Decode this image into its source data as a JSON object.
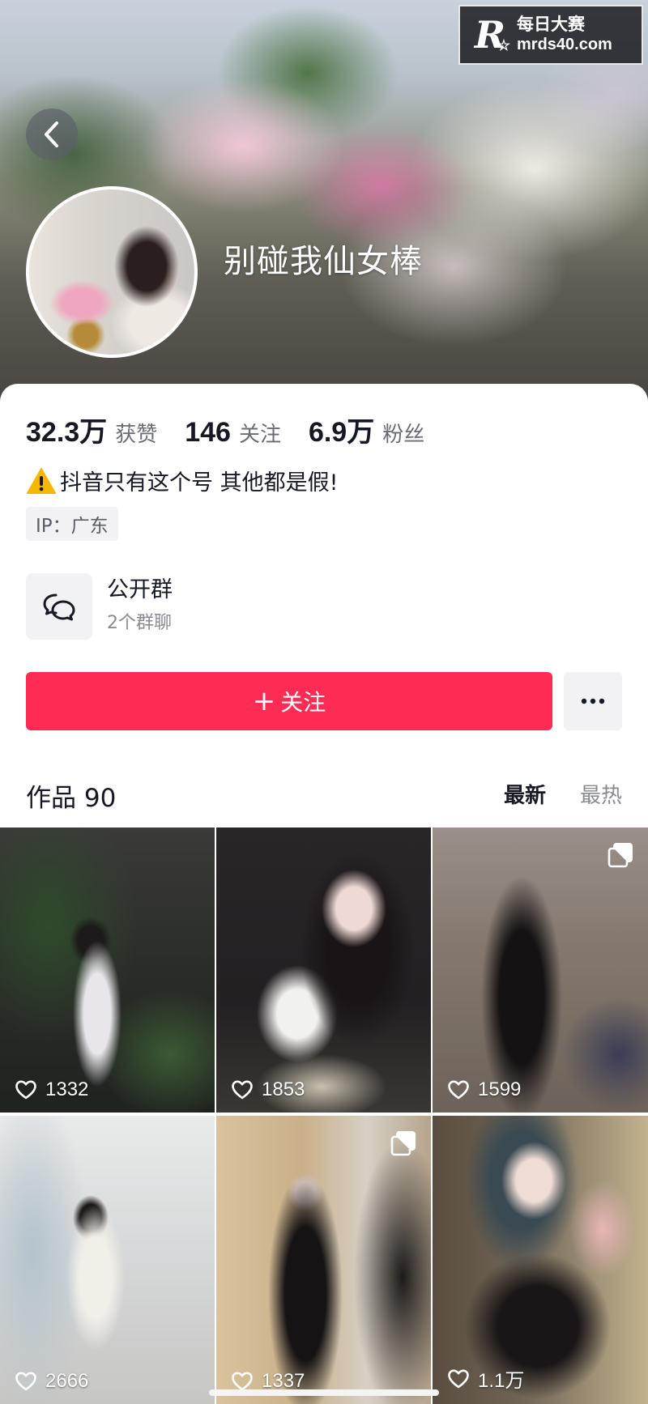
{
  "watermark": {
    "logo": "R",
    "line1": "每日大赛",
    "line2": "mrds40.com"
  },
  "profile": {
    "name": "别碰我仙女棒"
  },
  "stats": [
    {
      "value": "32.3万",
      "label": "获赞"
    },
    {
      "value": "146",
      "label": "关注"
    },
    {
      "value": "6.9万",
      "label": "粉丝"
    }
  ],
  "bio": {
    "icon": "warning-icon",
    "text": "抖音只有这个号 其他都是假!"
  },
  "ip": {
    "text": "IP：广东"
  },
  "group": {
    "icon": "chat-bubbles-icon",
    "title": "公开群",
    "subtitle": "2个群聊"
  },
  "actions": {
    "follow_label": "关注",
    "follow_plus": "+",
    "follow_color": "#fe2c55"
  },
  "works": {
    "title": "作品 90",
    "sort_tabs": [
      {
        "label": "最新",
        "active": true
      },
      {
        "label": "最热",
        "active": false
      }
    ],
    "items": [
      {
        "likes": "1332",
        "multi": false
      },
      {
        "likes": "1853",
        "multi": false
      },
      {
        "likes": "1599",
        "multi": true
      },
      {
        "likes": "2666",
        "multi": false
      },
      {
        "likes": "1337",
        "multi": true
      },
      {
        "likes": "1.1万",
        "multi": false
      }
    ]
  }
}
